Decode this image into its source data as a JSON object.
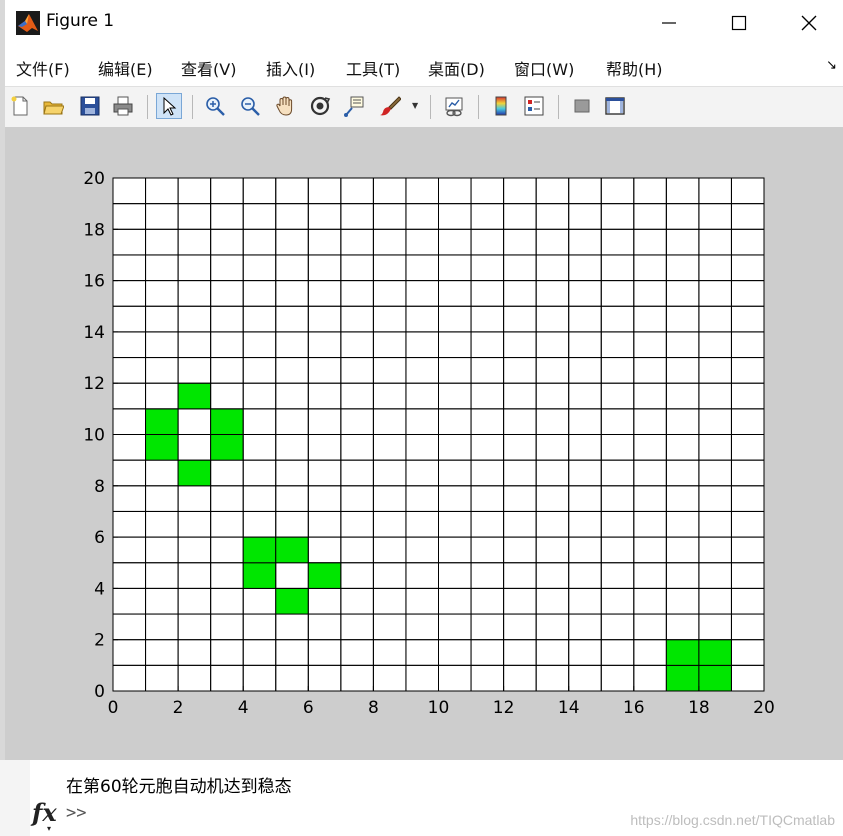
{
  "window": {
    "title": "Figure 1",
    "controls": {
      "minimize": "minimize",
      "maximize": "maximize",
      "close": "close"
    }
  },
  "menubar": {
    "items": [
      {
        "label": "文件(F)"
      },
      {
        "label": "编辑(E)"
      },
      {
        "label": "查看(V)"
      },
      {
        "label": "插入(I)"
      },
      {
        "label": "工具(T)"
      },
      {
        "label": "桌面(D)"
      },
      {
        "label": "窗口(W)"
      },
      {
        "label": "帮助(H)"
      }
    ],
    "dock_glyph": "↘"
  },
  "toolbar": {
    "buttons": [
      {
        "icon": "new-figure-icon"
      },
      {
        "icon": "open-file-icon"
      },
      {
        "icon": "save-icon"
      },
      {
        "icon": "print-icon"
      },
      {
        "icon": "edit-plot-arrow-icon",
        "active": true
      },
      {
        "icon": "zoom-in-icon"
      },
      {
        "icon": "zoom-out-icon"
      },
      {
        "icon": "pan-hand-icon"
      },
      {
        "icon": "rotate-3d-icon"
      },
      {
        "icon": "data-cursor-icon"
      },
      {
        "icon": "brush-icon"
      },
      {
        "icon": "link-plot-icon"
      },
      {
        "icon": "colorbar-icon"
      },
      {
        "icon": "legend-icon"
      },
      {
        "icon": "hide-plot-tools-icon"
      },
      {
        "icon": "show-plot-tools-icon"
      }
    ]
  },
  "colors": {
    "live_cell": "#00e600",
    "grid_line": "#000000",
    "figure_background": "#cdcdcd",
    "axes_background": "#ffffff",
    "toolbar_background": "#f3f3f3"
  },
  "chart_data": {
    "type": "heatmap",
    "xlim": [
      0,
      20
    ],
    "ylim": [
      0,
      20
    ],
    "xticks": [
      0,
      2,
      4,
      6,
      8,
      10,
      12,
      14,
      16,
      18,
      20
    ],
    "yticks": [
      0,
      2,
      4,
      6,
      8,
      10,
      12,
      14,
      16,
      18,
      20
    ],
    "grid_cells": 20,
    "live_cells": [
      [
        2,
        11
      ],
      [
        1,
        10
      ],
      [
        3,
        10
      ],
      [
        1,
        9
      ],
      [
        3,
        9
      ],
      [
        2,
        8
      ],
      [
        4,
        5
      ],
      [
        5,
        5
      ],
      [
        4,
        4
      ],
      [
        6,
        4
      ],
      [
        5,
        3
      ],
      [
        17,
        1
      ],
      [
        18,
        1
      ],
      [
        17,
        0
      ],
      [
        18,
        0
      ]
    ],
    "cell_color": "#00e600",
    "grid": true
  },
  "command_window": {
    "output": "在第60轮元胞自动机达到稳态",
    "prompt": ">>",
    "fx_label": "fx",
    "fx_caret": "▾"
  },
  "watermark": "https://blog.csdn.net/TIQCmatlab"
}
